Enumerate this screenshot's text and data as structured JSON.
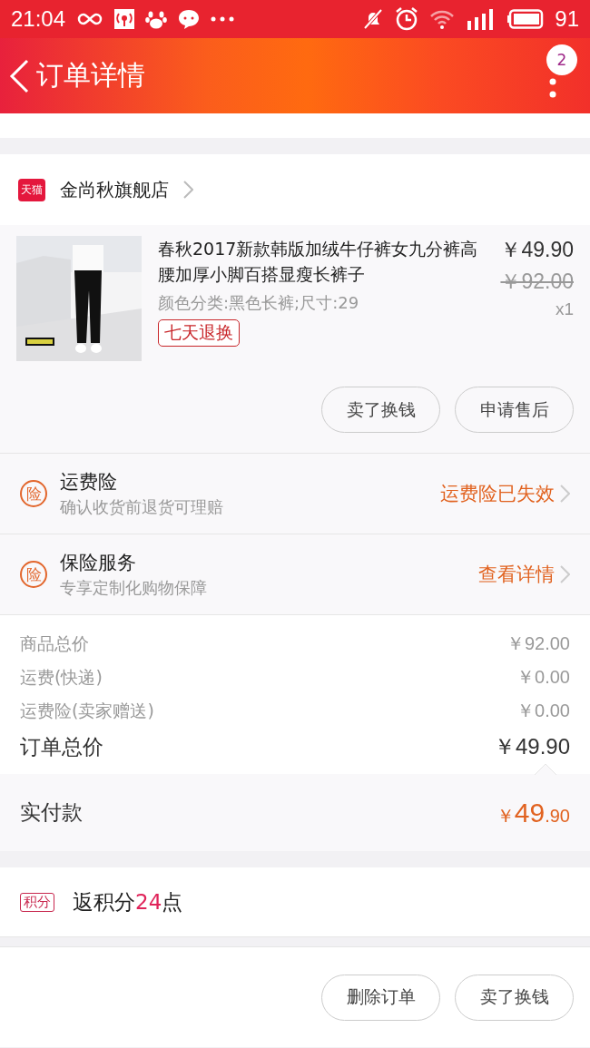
{
  "status_bar": {
    "time": "21:04",
    "battery": "91"
  },
  "header": {
    "title": "订单详情",
    "badge": "2"
  },
  "store": {
    "badge": "天猫",
    "name": "金尚秋旗舰店"
  },
  "product": {
    "image": {
      "kind": "picture"
    },
    "title": "春秋2017新款韩版加绒牛仔裤女九分裤高腰加厚小脚百搭显瘦长裤子",
    "sku": "颜色分类:黑色长裤;尺寸:29",
    "tag": "七天退换",
    "price": "￥49.90",
    "original_price": "￥92.00",
    "quantity": "x1",
    "actions": [
      "卖了换钱",
      "申请售后"
    ]
  },
  "services": [
    {
      "icon": "险",
      "title": "运费险",
      "subtitle": "确认收货前退货可理赔",
      "link": "运费险已失效"
    },
    {
      "icon": "险",
      "title": "保险服务",
      "subtitle": "专享定制化购物保障",
      "link": "查看详情"
    }
  ],
  "summary": [
    {
      "label": "商品总价",
      "value": "￥92.00"
    },
    {
      "label": "运费(快递)",
      "value": "￥0.00"
    },
    {
      "label": "运费险(卖家赠送)",
      "value": "￥0.00"
    }
  ],
  "order_total": {
    "label": "订单总价",
    "value": "￥49.90"
  },
  "paid": {
    "label": "实付款",
    "currency": "￥",
    "integer": "49",
    "decimal": ".90"
  },
  "points": {
    "badge": "积分",
    "before": "返积分",
    "value": "24",
    "after": "点"
  },
  "footer_buttons": [
    "删除订单",
    "卖了换钱"
  ]
}
